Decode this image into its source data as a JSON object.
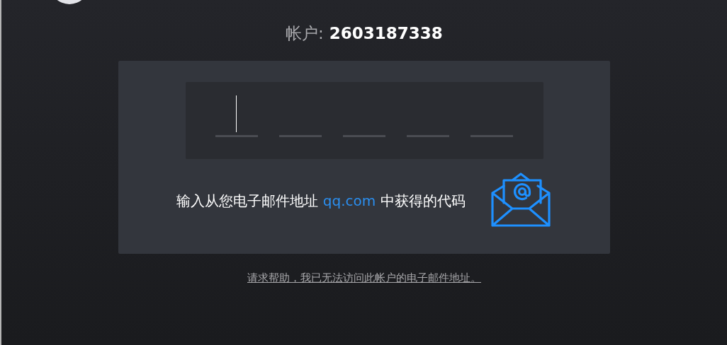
{
  "account": {
    "label": "帐户:",
    "number": "2603187338"
  },
  "code_digits": [
    {
      "focused": true
    },
    {
      "focused": false
    },
    {
      "focused": false
    },
    {
      "focused": false
    },
    {
      "focused": false
    }
  ],
  "instruction": {
    "before": "输入从您电子邮件地址",
    "domain": "qq.com",
    "after": "中获得的代码"
  },
  "help_link": "请求帮助，我已无法访问此帐户的电子邮件地址。"
}
